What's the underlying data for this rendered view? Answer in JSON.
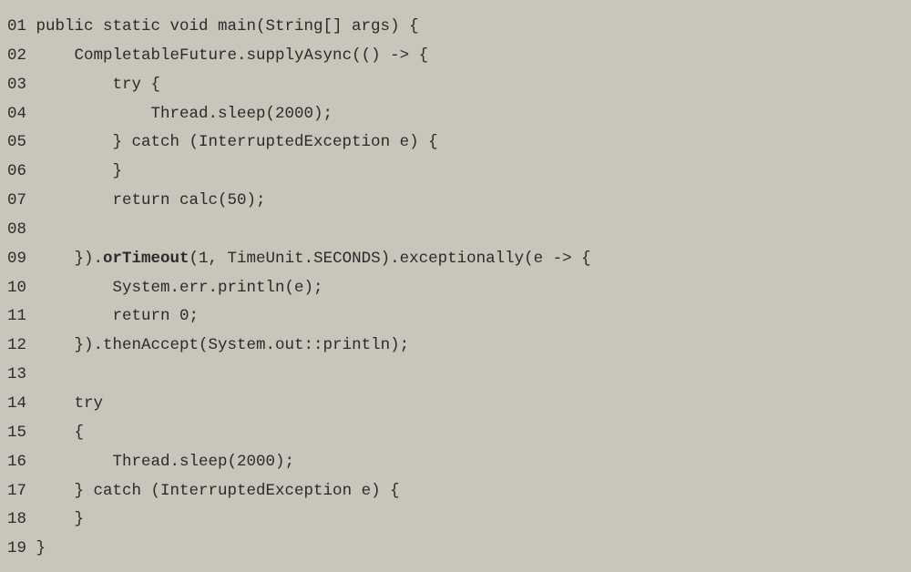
{
  "code": {
    "lines": [
      {
        "num": "01",
        "indent": "",
        "segments": [
          {
            "text": "public static void main(String[] args) {",
            "bold": false
          }
        ]
      },
      {
        "num": "02",
        "indent": "    ",
        "segments": [
          {
            "text": "CompletableFuture.supplyAsync(() -> {",
            "bold": false
          }
        ]
      },
      {
        "num": "03",
        "indent": "        ",
        "segments": [
          {
            "text": "try {",
            "bold": false
          }
        ]
      },
      {
        "num": "04",
        "indent": "            ",
        "segments": [
          {
            "text": "Thread.sleep(2000);",
            "bold": false
          }
        ]
      },
      {
        "num": "05",
        "indent": "        ",
        "segments": [
          {
            "text": "} catch (InterruptedException e) {",
            "bold": false
          }
        ]
      },
      {
        "num": "06",
        "indent": "        ",
        "segments": [
          {
            "text": "}",
            "bold": false
          }
        ]
      },
      {
        "num": "07",
        "indent": "        ",
        "segments": [
          {
            "text": "return calc(50);",
            "bold": false
          }
        ]
      },
      {
        "num": "08",
        "indent": "",
        "segments": [
          {
            "text": "",
            "bold": false
          }
        ]
      },
      {
        "num": "09",
        "indent": "    ",
        "segments": [
          {
            "text": "}).",
            "bold": false
          },
          {
            "text": "orTimeout",
            "bold": true
          },
          {
            "text": "(1, TimeUnit.SECONDS).exceptionally(e -> {",
            "bold": false
          }
        ]
      },
      {
        "num": "10",
        "indent": "        ",
        "segments": [
          {
            "text": "System.err.println(e);",
            "bold": false
          }
        ]
      },
      {
        "num": "11",
        "indent": "        ",
        "segments": [
          {
            "text": "return 0;",
            "bold": false
          }
        ]
      },
      {
        "num": "12",
        "indent": "    ",
        "segments": [
          {
            "text": "}).thenAccept(System.out::println);",
            "bold": false
          }
        ]
      },
      {
        "num": "13",
        "indent": "",
        "segments": [
          {
            "text": "",
            "bold": false
          }
        ]
      },
      {
        "num": "14",
        "indent": "    ",
        "segments": [
          {
            "text": "try",
            "bold": false
          }
        ]
      },
      {
        "num": "15",
        "indent": "    ",
        "segments": [
          {
            "text": "{",
            "bold": false
          }
        ]
      },
      {
        "num": "16",
        "indent": "        ",
        "segments": [
          {
            "text": "Thread.sleep(2000);",
            "bold": false
          }
        ]
      },
      {
        "num": "17",
        "indent": "    ",
        "segments": [
          {
            "text": "} catch (InterruptedException e) {",
            "bold": false
          }
        ]
      },
      {
        "num": "18",
        "indent": "    ",
        "segments": [
          {
            "text": "}",
            "bold": false
          }
        ]
      },
      {
        "num": "19",
        "indent": "",
        "segments": [
          {
            "text": "}",
            "bold": false
          }
        ]
      }
    ]
  }
}
